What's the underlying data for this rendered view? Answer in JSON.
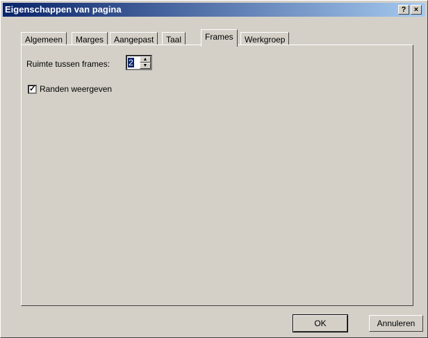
{
  "window": {
    "title": "Eigenschappen van pagina",
    "help_glyph": "?",
    "close_glyph": "×"
  },
  "tabs": [
    {
      "label": "Algemeen",
      "active": false
    },
    {
      "label": "Marges",
      "active": false
    },
    {
      "label": "Aangepast",
      "active": false
    },
    {
      "label": "Taal",
      "active": false
    },
    {
      "label": "Frames",
      "active": true
    },
    {
      "label": "Werkgroep",
      "active": false
    }
  ],
  "frames_panel": {
    "spacing_label": "Ruimte tussen frames:",
    "spacing_value": "2",
    "border_checkbox": {
      "label": "Randen weergeven",
      "checked": true,
      "mark": "✓"
    }
  },
  "buttons": {
    "ok": "OK",
    "cancel": "Annuleren"
  }
}
